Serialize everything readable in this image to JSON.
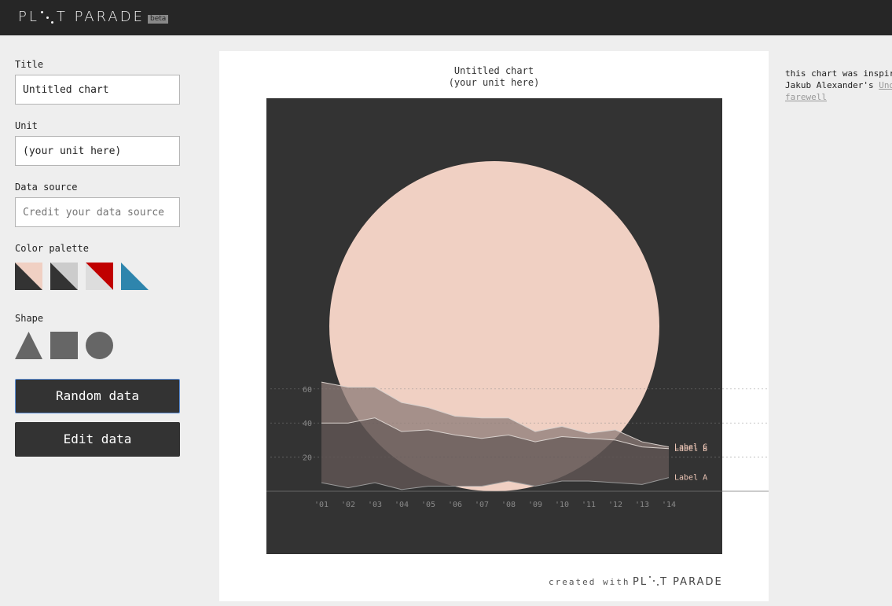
{
  "header": {
    "logo_left": "PL",
    "logo_right": "T PARADE",
    "badge": "beta"
  },
  "sidebar": {
    "title_label": "Title",
    "title_value": "Untitled chart",
    "unit_label": "Unit",
    "unit_value": "(your unit here)",
    "source_label": "Data source",
    "source_placeholder": "Credit your data source",
    "palette_label": "Color palette",
    "palettes": [
      {
        "name": "peach-dark",
        "a": "#f0d0c3",
        "b": "#333333"
      },
      {
        "name": "grey-dark",
        "a": "#cccccc",
        "b": "#333333"
      },
      {
        "name": "red-light",
        "a": "#c00000",
        "b": "#dddddd"
      },
      {
        "name": "blue-light",
        "a": "#eeeeee",
        "b": "#2e85ad"
      }
    ],
    "shape_label": "Shape",
    "shapes": [
      "triangle-icon",
      "square-icon",
      "circle-icon"
    ],
    "random_button": "Random data",
    "edit_button": "Edit data"
  },
  "chart_data": {
    "type": "area",
    "title": "Untitled chart",
    "subtitle": "(your unit here)",
    "categories": [
      "'01",
      "'02",
      "'03",
      "'04",
      "'05",
      "'06",
      "'07",
      "'08",
      "'09",
      "'10",
      "'11",
      "'12",
      "'13",
      "'14"
    ],
    "series": [
      {
        "name": "Label A",
        "values": [
          5,
          2,
          5,
          1,
          3,
          3,
          3,
          6,
          3,
          6,
          6,
          5,
          4,
          8
        ]
      },
      {
        "name": "Label B",
        "values": [
          40,
          40,
          43,
          35,
          36,
          33,
          31,
          33,
          29,
          32,
          31,
          30,
          26,
          25
        ]
      },
      {
        "name": "Label C",
        "values": [
          64,
          61,
          61,
          52,
          49,
          44,
          43,
          43,
          35,
          38,
          34,
          36,
          29,
          26
        ]
      }
    ],
    "y_ticks": [
      20,
      40,
      60
    ],
    "ylim": [
      0,
      100
    ],
    "grid": true,
    "colors": {
      "background": "#333333",
      "shape": "#f0d0c3",
      "shape_name": "circle"
    }
  },
  "inspiration": {
    "line1": "this chart was inspir",
    "line2_prefix": "Jakub Alexander's ",
    "line2_link": "Und",
    "line3_link": "farewell"
  },
  "footer": {
    "credit": "created with",
    "logo_left": "PL",
    "logo_right": "T PARADE"
  }
}
